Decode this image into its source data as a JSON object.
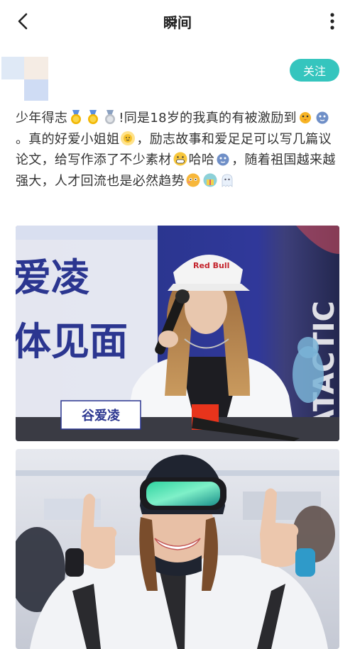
{
  "header": {
    "title": "瞬间",
    "back_icon": "chevron-left-icon",
    "more_icon": "more-vertical-icon"
  },
  "post": {
    "follow_label": "关注",
    "text_segments": [
      "少年得志",
      "!同是18岁的我真的有被激励到",
      "。真的好爱小姐姐",
      "，励志故事和爱足足可以写几篇议论文，给写作添了不少素材",
      "哈哈",
      "，随着祖国越来越强大，人才回流也是必然趋势"
    ],
    "emoji_names": [
      "gold-medal",
      "gold-medal",
      "silver-medal",
      "chick",
      "blue-blob",
      "sun-face",
      "grin-face",
      "blue-blob",
      "pleading-face",
      "gift-face",
      "ghost"
    ]
  },
  "photos": {
    "photo1": {
      "banner_line1": "爱凌",
      "banner_line2": "体见面",
      "name_card": "谷爱凌",
      "cap_text": "Red Bull",
      "side_text": "ATACTIC"
    },
    "photo2": {}
  },
  "colors": {
    "accent": "#35c5be",
    "banner_blue": "#2a2f86"
  }
}
